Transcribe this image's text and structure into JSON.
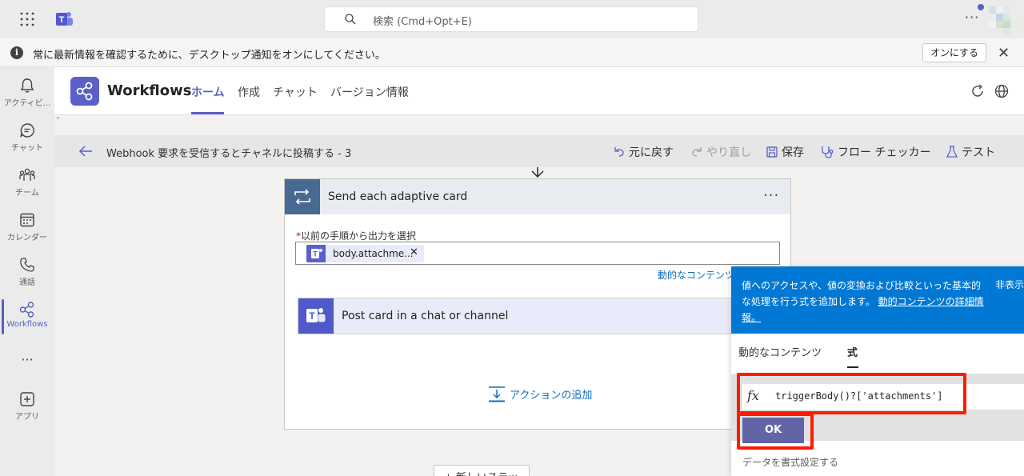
{
  "topbar": {
    "search_placeholder": "検索 (Cmd+Opt+E)",
    "more": "···"
  },
  "notification": {
    "message": "常に最新情報を確認するために、デスクトップ通知をオンにしてください。",
    "turn_on_label": "オンにする",
    "info_glyph": "i",
    "close_glyph": "✕"
  },
  "rail": {
    "items": [
      {
        "label": "アクティビ...",
        "icon": "bell-icon"
      },
      {
        "label": "チャット",
        "icon": "chat-icon"
      },
      {
        "label": "チーム",
        "icon": "teams-icon"
      },
      {
        "label": "カレンダー",
        "icon": "calendar-icon"
      },
      {
        "label": "通話",
        "icon": "phone-icon"
      },
      {
        "label": "Workflows",
        "icon": "workflows-icon"
      },
      {
        "label": "",
        "icon": "more-icon"
      },
      {
        "label": "アプリ",
        "icon": "apps-icon"
      }
    ],
    "more_glyph": "···"
  },
  "app": {
    "title": "Workflows",
    "tabs": [
      "ホーム",
      "作成",
      "チャット",
      "バージョン情報"
    ]
  },
  "workspace": {
    "stray_char": "`"
  },
  "cmdbar": {
    "title": "Webhook 要求を受信するとチャネルに投稿する - 3",
    "undo": "元に戻す",
    "redo": "やり直し",
    "save": "保存",
    "flow_checker": "フロー チェッカー",
    "test": "テスト"
  },
  "loop": {
    "title": "Send each adaptive card",
    "more": "···",
    "field_required": "*",
    "field_label": "以前の手順から出力を選択",
    "token_label": "body.attachme...",
    "token_remove": "✕",
    "dynamic_link": "動的なコンテンツ"
  },
  "post": {
    "title": "Post card in a chat or channel"
  },
  "add_action": "アクションの追加",
  "new_step": "+ 新しいステッ",
  "expression": {
    "info_text": "値へのアクセスや、値の変換および比較といった基本的な処理を行う式を追加します。",
    "info_link": "動的コンテンツの詳細情報。",
    "hide": "非表示",
    "tab_dynamic": "動的なコンテンツ",
    "tab_expression": "式",
    "fx": "fx",
    "value": "triggerBody()?['attachments']",
    "ok": "OK",
    "footer": "データを書式設定する"
  },
  "colors": {
    "accent": "#5b5fc7",
    "info_blue": "#0078d4",
    "highlight_red": "#ff1a00"
  }
}
